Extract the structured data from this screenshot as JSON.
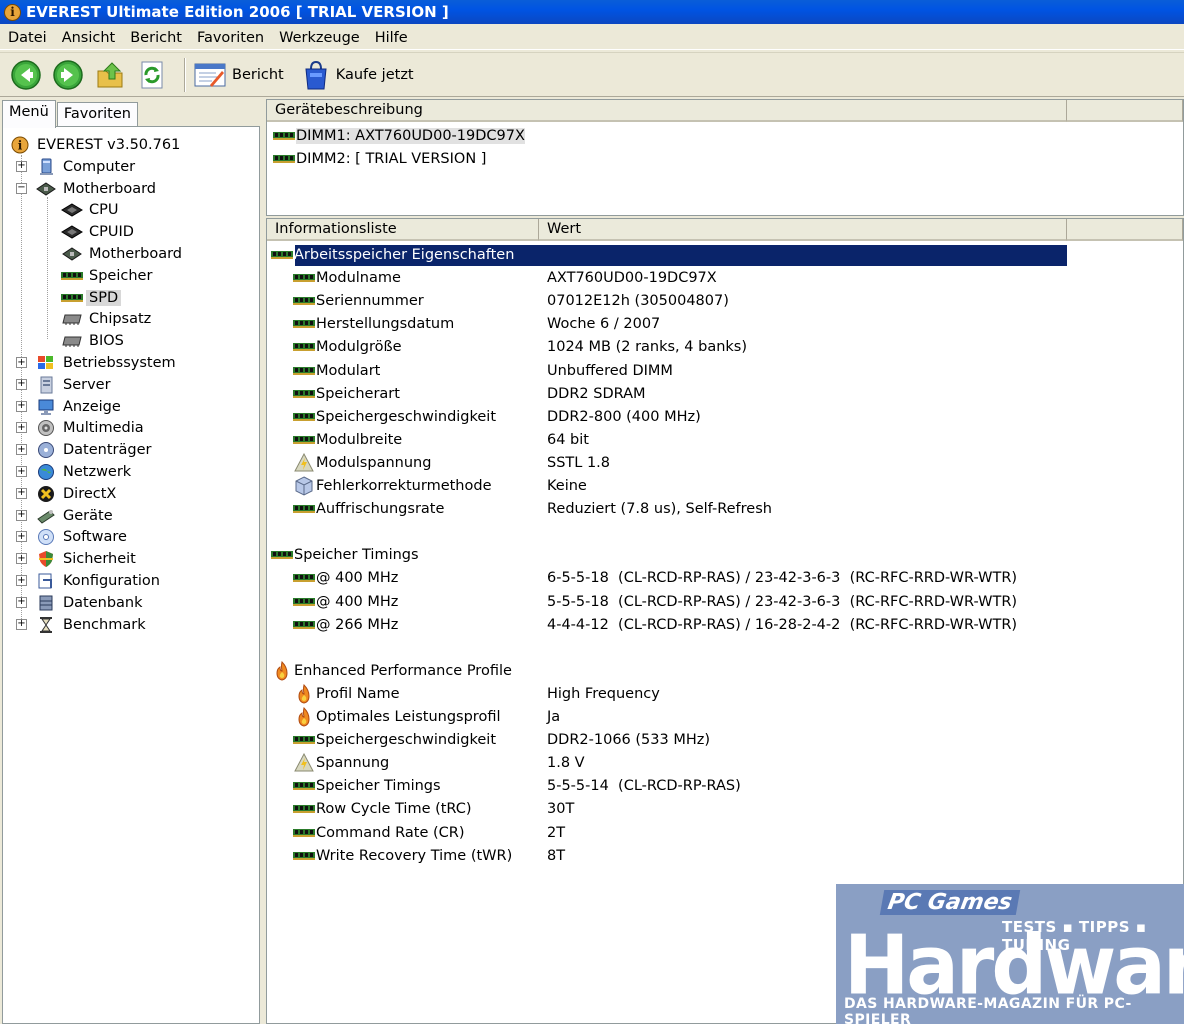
{
  "window": {
    "title": "EVEREST Ultimate Edition 2006  [ TRIAL VERSION ]"
  },
  "menubar": {
    "items": [
      "Datei",
      "Ansicht",
      "Bericht",
      "Favoriten",
      "Werkzeuge",
      "Hilfe"
    ]
  },
  "toolbar": {
    "report_label": "Bericht",
    "buy_label": "Kaufe jetzt"
  },
  "left_tabs": [
    "Menü",
    "Favoriten"
  ],
  "tree": {
    "root": "EVEREST v3.50.761",
    "items": [
      {
        "label": "Computer",
        "icon": "computer-icon",
        "level": 1,
        "expander": "+"
      },
      {
        "label": "Motherboard",
        "icon": "motherboard-icon",
        "level": 1,
        "expander": "-"
      },
      {
        "label": "CPU",
        "icon": "cpu-icon",
        "level": 2
      },
      {
        "label": "CPUID",
        "icon": "cpu-icon",
        "level": 2
      },
      {
        "label": "Motherboard",
        "icon": "motherboard-icon",
        "level": 2
      },
      {
        "label": "Speicher",
        "icon": "ram-module-icon",
        "level": 2
      },
      {
        "label": "SPD",
        "icon": "ram-module-icon",
        "level": 2,
        "selected": true
      },
      {
        "label": "Chipsatz",
        "icon": "chip-icon",
        "level": 2
      },
      {
        "label": "BIOS",
        "icon": "chip-icon",
        "level": 2
      },
      {
        "label": "Betriebssystem",
        "icon": "windows-icon",
        "level": 1,
        "expander": "+"
      },
      {
        "label": "Server",
        "icon": "server-icon",
        "level": 1,
        "expander": "+"
      },
      {
        "label": "Anzeige",
        "icon": "display-icon",
        "level": 1,
        "expander": "+"
      },
      {
        "label": "Multimedia",
        "icon": "speaker-icon",
        "level": 1,
        "expander": "+"
      },
      {
        "label": "Datenträger",
        "icon": "disk-icon",
        "level": 1,
        "expander": "+"
      },
      {
        "label": "Netzwerk",
        "icon": "network-globe-icon",
        "level": 1,
        "expander": "+"
      },
      {
        "label": "DirectX",
        "icon": "directx-icon",
        "level": 1,
        "expander": "+"
      },
      {
        "label": "Geräte",
        "icon": "devices-icon",
        "level": 1,
        "expander": "+"
      },
      {
        "label": "Software",
        "icon": "software-icon",
        "level": 1,
        "expander": "+"
      },
      {
        "label": "Sicherheit",
        "icon": "shield-icon",
        "level": 1,
        "expander": "+"
      },
      {
        "label": "Konfiguration",
        "icon": "configuration-icon",
        "level": 1,
        "expander": "+"
      },
      {
        "label": "Datenbank",
        "icon": "database-icon",
        "level": 1,
        "expander": "+"
      },
      {
        "label": "Benchmark",
        "icon": "hourglass-icon",
        "level": 1,
        "expander": "+"
      }
    ]
  },
  "device_panel": {
    "header": "Gerätebeschreibung",
    "devices": [
      {
        "label": "DIMM1: AXT760UD00-19DC97X",
        "selected": true
      },
      {
        "label": "DIMM2: [ TRIAL VERSION ]",
        "selected": false
      }
    ]
  },
  "info_panel": {
    "headers": [
      "Informationsliste",
      "Wert"
    ],
    "rows": [
      {
        "type": "group",
        "icon": "ram-module-icon",
        "name": "Arbeitsspeicher Eigenschaften",
        "value": "",
        "selected": true
      },
      {
        "type": "item",
        "icon": "ram-module-icon",
        "name": "Modulname",
        "value": "AXT760UD00-19DC97X"
      },
      {
        "type": "item",
        "icon": "ram-module-icon",
        "name": "Seriennummer",
        "value": "07012E12h (305004807)"
      },
      {
        "type": "item",
        "icon": "ram-module-icon",
        "name": "Herstellungsdatum",
        "value": "Woche 6 / 2007"
      },
      {
        "type": "item",
        "icon": "ram-module-icon",
        "name": "Modulgröße",
        "value": "1024 MB (2 ranks, 4 banks)"
      },
      {
        "type": "item",
        "icon": "ram-module-icon",
        "name": "Modulart",
        "value": "Unbuffered DIMM"
      },
      {
        "type": "item",
        "icon": "ram-module-icon",
        "name": "Speicherart",
        "value": "DDR2 SDRAM"
      },
      {
        "type": "item",
        "icon": "ram-module-icon",
        "name": "Speichergeschwindigkeit",
        "value": "DDR2-800 (400 MHz)"
      },
      {
        "type": "item",
        "icon": "ram-module-icon",
        "name": "Modulbreite",
        "value": "64 bit"
      },
      {
        "type": "item",
        "icon": "voltage-warning-icon",
        "name": "Modulspannung",
        "value": "SSTL 1.8"
      },
      {
        "type": "item",
        "icon": "shield-cube-icon",
        "name": "Fehlerkorrekturmethode",
        "value": "Keine"
      },
      {
        "type": "item",
        "icon": "ram-module-icon",
        "name": "Auffrischungsrate",
        "value": "Reduziert (7.8 us), Self-Refresh"
      },
      {
        "type": "spacer"
      },
      {
        "type": "group",
        "icon": "ram-module-icon",
        "name": "Speicher Timings",
        "value": ""
      },
      {
        "type": "item",
        "icon": "ram-module-icon",
        "name": "@ 400 MHz",
        "value": "6-5-5-18  (CL-RCD-RP-RAS) / 23-42-3-6-3  (RC-RFC-RRD-WR-WTR)"
      },
      {
        "type": "item",
        "icon": "ram-module-icon",
        "name": "@ 400 MHz",
        "value": "5-5-5-18  (CL-RCD-RP-RAS) / 23-42-3-6-3  (RC-RFC-RRD-WR-WTR)"
      },
      {
        "type": "item",
        "icon": "ram-module-icon",
        "name": "@ 266 MHz",
        "value": "4-4-4-12  (CL-RCD-RP-RAS) / 16-28-2-4-2  (RC-RFC-RRD-WR-WTR)"
      },
      {
        "type": "spacer"
      },
      {
        "type": "group",
        "icon": "flame-icon",
        "name": "Enhanced Performance Profile",
        "value": ""
      },
      {
        "type": "item",
        "icon": "flame-icon",
        "name": "Profil Name",
        "value": "High Frequency"
      },
      {
        "type": "item",
        "icon": "flame-icon",
        "name": "Optimales Leistungsprofil",
        "value": "Ja"
      },
      {
        "type": "item",
        "icon": "ram-module-icon",
        "name": "Speichergeschwindigkeit",
        "value": "DDR2-1066 (533 MHz)"
      },
      {
        "type": "item",
        "icon": "voltage-warning-icon",
        "name": "Spannung",
        "value": "1.8 V"
      },
      {
        "type": "item",
        "icon": "ram-module-icon",
        "name": "Speicher Timings",
        "value": "5-5-5-14  (CL-RCD-RP-RAS)"
      },
      {
        "type": "item",
        "icon": "ram-module-icon",
        "name": "Row Cycle Time (tRC)",
        "value": "30T"
      },
      {
        "type": "item",
        "icon": "ram-module-icon",
        "name": "Command Rate (CR)",
        "value": "2T"
      },
      {
        "type": "item",
        "icon": "ram-module-icon",
        "name": "Write Recovery Time (tWR)",
        "value": "8T"
      }
    ]
  },
  "watermark": {
    "pc": "PC Games",
    "tagline": "TESTS ▪ TIPPS ▪ TUNING",
    "brand": "Hardware",
    "subline": "DAS HARDWARE-MAGAZIN FÜR PC-SPIELER"
  }
}
